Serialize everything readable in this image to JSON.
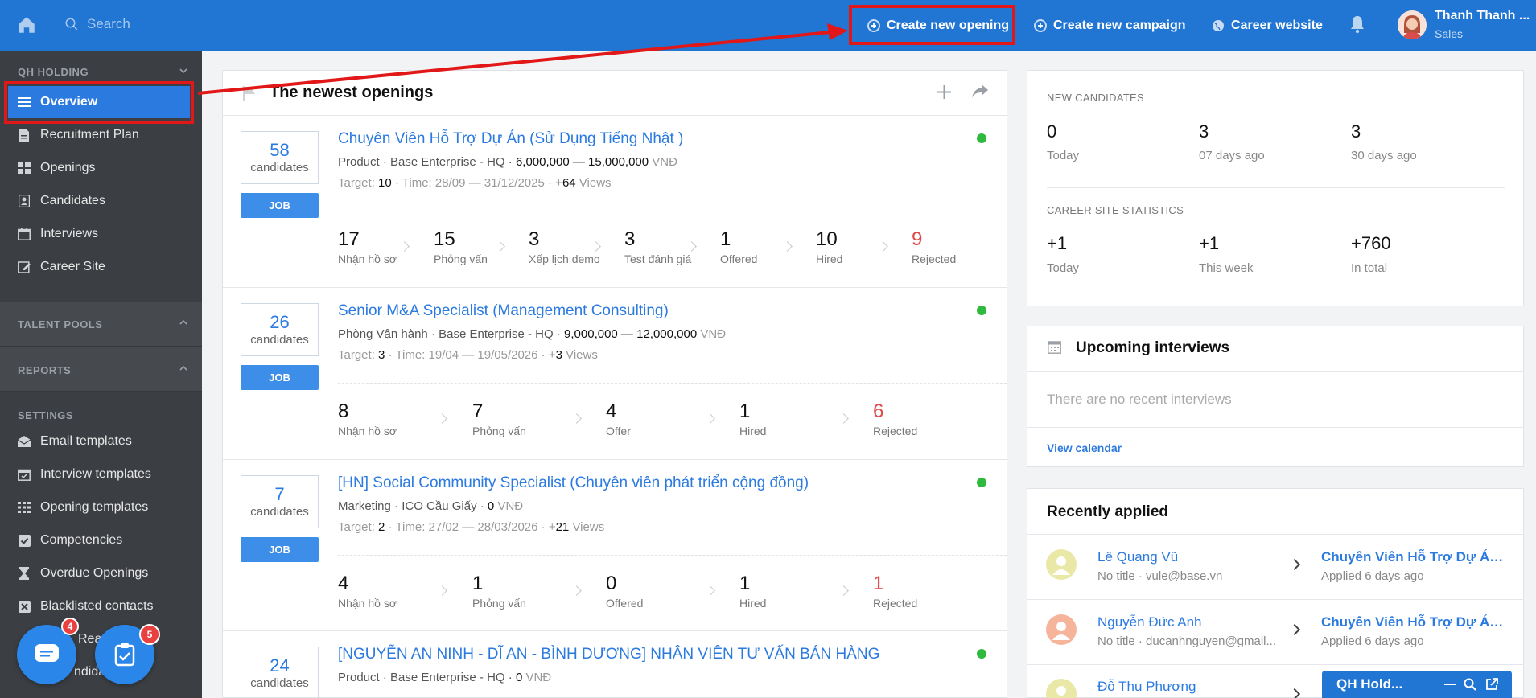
{
  "topbar": {
    "search_placeholder": "Search",
    "create_opening": "Create new opening",
    "create_campaign": "Create new campaign",
    "career_website": "Career website",
    "user_name": "Thanh Thanh ...",
    "user_role": "Sales"
  },
  "sidebar": {
    "company": "QH HOLDING",
    "items": [
      {
        "label": "Overview",
        "icon": "menu-icon"
      },
      {
        "label": "Recruitment Plan",
        "icon": "document-icon"
      },
      {
        "label": "Openings",
        "icon": "grid-icon"
      },
      {
        "label": "Candidates",
        "icon": "contact-icon"
      },
      {
        "label": "Interviews",
        "icon": "calendar-icon"
      },
      {
        "label": "Career Site",
        "icon": "edit-icon"
      }
    ],
    "talent_pools": "TALENT POOLS",
    "reports": "REPORTS",
    "settings": "SETTINGS",
    "settings_items": [
      {
        "label": "Email templates"
      },
      {
        "label": "Interview templates"
      },
      {
        "label": "Opening templates"
      },
      {
        "label": "Competencies"
      },
      {
        "label": "Overdue Openings"
      },
      {
        "label": "Blacklisted contacts"
      },
      {
        "label": "Rea"
      },
      {
        "label": "ndidate"
      }
    ],
    "bubble1_badge": "4",
    "bubble2_badge": "5"
  },
  "openings": {
    "title": "The newest openings",
    "list": [
      {
        "count": "58",
        "count_label": "candidates",
        "job": "JOB",
        "title": "Chuyên Viên Hỗ Trợ Dự Án (Sử Dụng Tiếng Nhật )",
        "dept": "Product",
        "office": "Base Enterprise - HQ",
        "salary_min": "6,000,000",
        "salary_max": "15,000,000",
        "currency": "VNĐ",
        "target_label": "Target:",
        "target": "10",
        "time": "Time: 28/09 — 31/12/2025",
        "views": "64",
        "views_label": "Views",
        "stages": [
          {
            "n": "17",
            "l": "Nhận hồ sơ"
          },
          {
            "n": "15",
            "l": "Phỏng vấn"
          },
          {
            "n": "3",
            "l": "Xếp lịch demo"
          },
          {
            "n": "3",
            "l": "Test đánh giá"
          },
          {
            "n": "1",
            "l": "Offered"
          },
          {
            "n": "10",
            "l": "Hired"
          },
          {
            "n": "9",
            "l": "Rejected"
          }
        ]
      },
      {
        "count": "26",
        "count_label": "candidates",
        "job": "JOB",
        "title": "Senior M&A Specialist (Management Consulting)",
        "dept": "Phòng Vận hành",
        "office": "Base Enterprise - HQ",
        "salary_min": "9,000,000",
        "salary_max": "12,000,000",
        "currency": "VNĐ",
        "target_label": "Target:",
        "target": "3",
        "time": "Time: 19/04 — 19/05/2026",
        "views": "3",
        "views_label": "Views",
        "stages": [
          {
            "n": "8",
            "l": "Nhận hồ sơ"
          },
          {
            "n": "7",
            "l": "Phỏng vấn"
          },
          {
            "n": "4",
            "l": "Offer"
          },
          {
            "n": "1",
            "l": "Hired"
          },
          {
            "n": "6",
            "l": "Rejected"
          }
        ]
      },
      {
        "count": "7",
        "count_label": "candidates",
        "job": "JOB",
        "title": "[HN] Social Community Specialist (Chuyên viên phát triển cộng đồng)",
        "dept": "Marketing",
        "office": "ICO Cầu Giấy",
        "salary": "0",
        "currency": "VNĐ",
        "target_label": "Target:",
        "target": "2",
        "time": "Time: 27/02 — 28/03/2026",
        "views": "21",
        "views_label": "Views",
        "stages": [
          {
            "n": "4",
            "l": "Nhận hồ sơ"
          },
          {
            "n": "1",
            "l": "Phỏng vấn"
          },
          {
            "n": "0",
            "l": "Offered"
          },
          {
            "n": "1",
            "l": "Hired"
          },
          {
            "n": "1",
            "l": "Rejected"
          }
        ]
      },
      {
        "count": "24",
        "count_label": "candidates",
        "title": "[NGUYỄN AN NINH - DĨ AN - BÌNH DƯƠNG] NHÂN VIÊN TƯ VẤN BÁN HÀNG",
        "dept": "Product",
        "office": "Base Enterprise - HQ",
        "salary": "0",
        "currency": "VNĐ"
      }
    ]
  },
  "new_candidates": {
    "heading": "NEW CANDIDATES",
    "stats": [
      {
        "n": "0",
        "l": "Today"
      },
      {
        "n": "3",
        "l": "07 days ago"
      },
      {
        "n": "3",
        "l": "30 days ago"
      }
    ]
  },
  "career_stats": {
    "heading": "CAREER SITE STATISTICS",
    "stats": [
      {
        "n": "+1",
        "l": "Today"
      },
      {
        "n": "+1",
        "l": "This week"
      },
      {
        "n": "+760",
        "l": "In total"
      }
    ]
  },
  "interviews": {
    "title": "Upcoming interviews",
    "empty": "There are no recent interviews",
    "view_calendar": "View calendar"
  },
  "recently_applied": {
    "title": "Recently applied",
    "list": [
      {
        "name": "Lê Quang Vũ",
        "sub": "No title · vule@base.vn",
        "job": "Chuyên Viên Hỗ Trợ Dự Án (Sử Dụng Tiếng Nhật )",
        "applied": "Applied 6 days ago",
        "color": "#e9e8a6"
      },
      {
        "name": "Nguyễn Đức Anh",
        "sub": "No title · ducanhnguyen@gmail...",
        "job": "Chuyên Viên Hỗ Trợ Dự Án (Sử Dụng Tiếng Nhật )",
        "applied": "Applied 6 days ago",
        "color": "#f6b59a"
      },
      {
        "name": "Đỗ Thu Phương",
        "color": "#e9e8a6"
      }
    ]
  },
  "chat": {
    "label": "QH Hold..."
  },
  "colors": {
    "topbar": "#2175d3",
    "accent": "#2b7ae0",
    "sidebar": "#3b3e43",
    "highlight": "#e21717",
    "status": "#2fba3d",
    "rejected": "#e04848"
  }
}
